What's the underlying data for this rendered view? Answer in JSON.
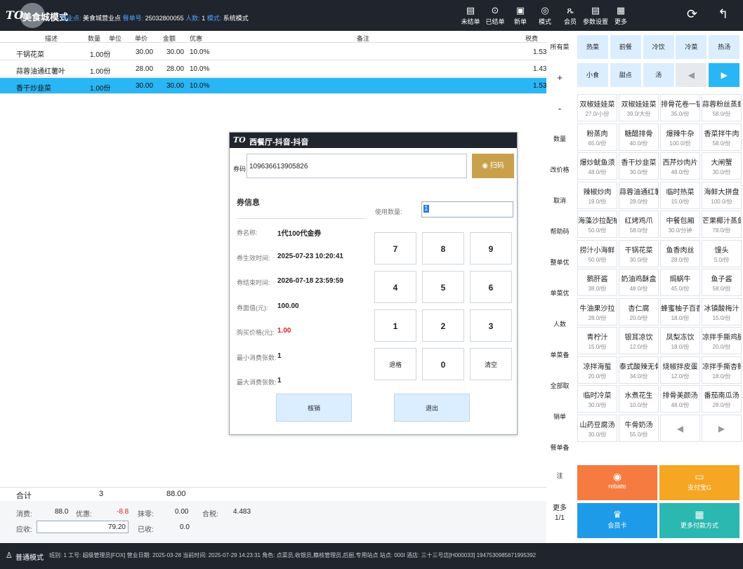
{
  "header": {
    "logo": "TO",
    "mode_title": "美食城模式",
    "business_point_label": "营业点:",
    "business_point": "美食城营业点",
    "order_no_label": "餐单号:",
    "order_no": "25032800055",
    "people_label": "人数:",
    "people": "1",
    "mode_label": "模式:",
    "mode": "系统模式",
    "buttons": [
      {
        "label": "未结单",
        "icon": "document-icon"
      },
      {
        "label": "已结单",
        "icon": "check-circle-icon"
      },
      {
        "label": "新单",
        "icon": "new-doc-icon"
      },
      {
        "label": "模式",
        "icon": "mode-icon"
      },
      {
        "label": "会员",
        "icon": "member-icon"
      },
      {
        "label": "参数设置",
        "icon": "settings-icon"
      },
      {
        "label": "更多",
        "icon": "grid-icon"
      }
    ]
  },
  "table": {
    "headers": [
      "描述",
      "数量",
      "单位",
      "单价",
      "金额",
      "优惠",
      "备注",
      "税费"
    ],
    "rows": [
      {
        "name": "干锅花菜",
        "qty": "1.00份",
        "price": "30.00",
        "amount": "30.00",
        "discount": "10.0%",
        "tax": "1.53"
      },
      {
        "name": "蒜蓉油通红薯叶",
        "qty": "1.00份",
        "price": "28.00",
        "amount": "28.00",
        "discount": "10.0%",
        "tax": "1.43"
      },
      {
        "name": "香干炒韭菜",
        "qty": "1.00份",
        "price": "30.00",
        "amount": "30.00",
        "discount": "10.0%",
        "tax": "1.53"
      }
    ]
  },
  "totals": {
    "label": "合计",
    "count": "3",
    "amount": "88.00",
    "consume_label": "消费:",
    "consume": "88.0",
    "discount_label": "优惠:",
    "discount": "-8.8",
    "zero_label": "抹零:",
    "zero": "0.00",
    "tax_label": "合税:",
    "tax": "4.483",
    "due_label": "应收:",
    "due": "79.20",
    "received_label": "已收:",
    "received": "0.0"
  },
  "mid_buttons": [
    "所有菜品",
    "+",
    "-",
    "数量",
    "改价格",
    "取消",
    "帮助码",
    "整单优惠",
    "单菜优惠",
    "人数",
    "单菜备注",
    "全部取消",
    "销单",
    "餐单备注"
  ],
  "more": {
    "label": "更多",
    "page": "1/1"
  },
  "categories": [
    "热菜",
    "前餐",
    "冷饮",
    "冷菜",
    "热汤",
    "小食",
    "甜点",
    "汤"
  ],
  "dishes": [
    {
      "n": "双椒娃娃菜",
      "p": "27.0/小份"
    },
    {
      "n": "双椒娃娃菜",
      "p": "39.0/大份"
    },
    {
      "n": "排骨花卷一锅出",
      "p": "35.0/份"
    },
    {
      "n": "蒜蓉粉丝蒸虾",
      "p": "58.0/份"
    },
    {
      "n": "粉蒸肉",
      "p": "65.0/份"
    },
    {
      "n": "糖醋排骨",
      "p": "40.0/份"
    },
    {
      "n": "爆辣牛杂",
      "p": "100.0/份"
    },
    {
      "n": "香菜拌牛肉",
      "p": "58.0/份"
    },
    {
      "n": "爆炒鱿鱼须",
      "p": "48.0/份"
    },
    {
      "n": "香干炒韭菜",
      "p": "30.0/份"
    },
    {
      "n": "西芹炒肉片",
      "p": "48.0/份"
    },
    {
      "n": "大闸蟹",
      "p": "30.0/份"
    },
    {
      "n": "辣椒炒肉",
      "p": "19.0/份"
    },
    {
      "n": "蒜蓉油通红薯叶",
      "p": "28.0/份"
    },
    {
      "n": "临时热菜",
      "p": "15.0/份"
    },
    {
      "n": "海鲜大拼盘",
      "p": "100.0/份"
    },
    {
      "n": "海藻沙拉配柚汁",
      "p": "50.0/份"
    },
    {
      "n": "红烤鸡爪",
      "p": "58.0/份"
    },
    {
      "n": "中餐包厢",
      "p": "30.0/分钟"
    },
    {
      "n": "芒果椰汁蒸鱼",
      "p": "78.0/份"
    },
    {
      "n": "捞汁小海鲜",
      "p": "50.0/份"
    },
    {
      "n": "干锅花菜",
      "p": "30.0/份"
    },
    {
      "n": "鱼香肉丝",
      "p": "28.0/份"
    },
    {
      "n": "馒头",
      "p": "5.0/份"
    },
    {
      "n": "鹅肝酱",
      "p": "38.0/份"
    },
    {
      "n": "奶油鸡酥盒",
      "p": "48.0/份"
    },
    {
      "n": "焗蜗牛",
      "p": "45.0/份"
    },
    {
      "n": "鱼子酱",
      "p": "58.0/份"
    },
    {
      "n": "牛油果沙拉",
      "p": "28.0/份"
    },
    {
      "n": "杏仁腐",
      "p": "20.0/份"
    },
    {
      "n": "蜂蜜柚子百香果",
      "p": "18.0/份"
    },
    {
      "n": "冰镇酸梅汁",
      "p": "15.0/份"
    },
    {
      "n": "青柠汁",
      "p": "15.0/份"
    },
    {
      "n": "银耳凉饮",
      "p": "12.0/份"
    },
    {
      "n": "凤梨冻饮",
      "p": "18.0/份"
    },
    {
      "n": "凉拌手撕鸡腿",
      "p": "20.0/份"
    },
    {
      "n": "凉拌海蜇",
      "p": "20.0/份"
    },
    {
      "n": "泰式酸辣无骨鸡爪",
      "p": "34.0/份"
    },
    {
      "n": "烧椒拌皮蛋",
      "p": "12.0/份"
    },
    {
      "n": "凉拌手撕杏鲍菇",
      "p": "18.0/份"
    },
    {
      "n": "临时冷菜",
      "p": "30.0/份"
    },
    {
      "n": "水煮花生",
      "p": "10.0/份"
    },
    {
      "n": "排骨美颜汤",
      "p": "48.0/份"
    },
    {
      "n": "番茄南瓜汤",
      "p": "28.0/份"
    },
    {
      "n": "山药豆腐汤",
      "p": "30.0/份"
    },
    {
      "n": "牛骨奶汤",
      "p": "55.0/份"
    }
  ],
  "pay_buttons": [
    {
      "label": "rebate",
      "color": "#f57b41",
      "icon": "rebate-icon"
    },
    {
      "label": "支付宝G",
      "color": "#f5a623",
      "icon": "wallet-icon"
    },
    {
      "label": "会员卡",
      "color": "#1e9be8",
      "icon": "crown-icon"
    },
    {
      "label": "更多付款方式",
      "color": "#2ab8b0",
      "icon": "grid-icon"
    }
  ],
  "dialog": {
    "title": "西餐厅-抖音-抖音",
    "code_label": "券码:",
    "code_value": "109636613905826",
    "scan_label": "扫码",
    "info_title": "券信息",
    "use_qty_label": "使用数量:",
    "use_qty": "1",
    "fields": [
      {
        "label": "券名称:",
        "value": "1代100代金券",
        "red": false
      },
      {
        "label": "券生效时间:",
        "value": "2025-07-23 10:20:41",
        "red": false
      },
      {
        "label": "券结束时间:",
        "value": "2026-07-18 23:59:59",
        "red": false
      },
      {
        "label": "券面值(元):",
        "value": "100.00",
        "red": false
      },
      {
        "label": "购买价格(元):",
        "value": "1.00",
        "red": true
      },
      {
        "label": "最小消费张数:",
        "value": "1",
        "red": false
      },
      {
        "label": "最大消费张数:",
        "value": "1",
        "red": false
      }
    ],
    "keys": [
      "7",
      "8",
      "9",
      "4",
      "5",
      "6",
      "1",
      "2",
      "3",
      "退格",
      "0",
      "清空"
    ],
    "verify_label": "核销",
    "exit_label": "退出"
  },
  "status": {
    "mode": "普通模式",
    "info": "班别: 1 工号: 超级管理员[FOX] 营业日期: 2025-03-28 当前时间: 2025-07-29 14:23:31 角色: 点菜员,收银员,籍核管理员,后厨,专用站点 站点: 000I 酒店: 三十三号店[H000033] 1947530985671995392"
  }
}
